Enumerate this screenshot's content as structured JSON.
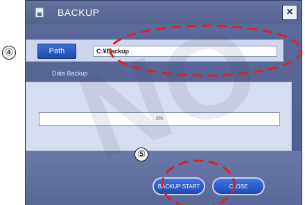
{
  "window": {
    "title": "BACKUP",
    "close_icon": "×"
  },
  "path": {
    "button_label": "Path",
    "value": "C:¥Backup"
  },
  "backup": {
    "section_label": "Data Backup",
    "progress_fraction": 0,
    "progress_text": "0%"
  },
  "buttons": {
    "start": "BACKUP START",
    "close": "CLOSE"
  },
  "annotations": {
    "marker_4": "④",
    "marker_5": "⑤"
  },
  "icons": {
    "app": "save-icon",
    "close": "close-icon"
  },
  "colors": {
    "accent": "#2356c8",
    "window": "#55628f",
    "panel": "#d7ddf0",
    "annotation_circles": "#e02020"
  }
}
